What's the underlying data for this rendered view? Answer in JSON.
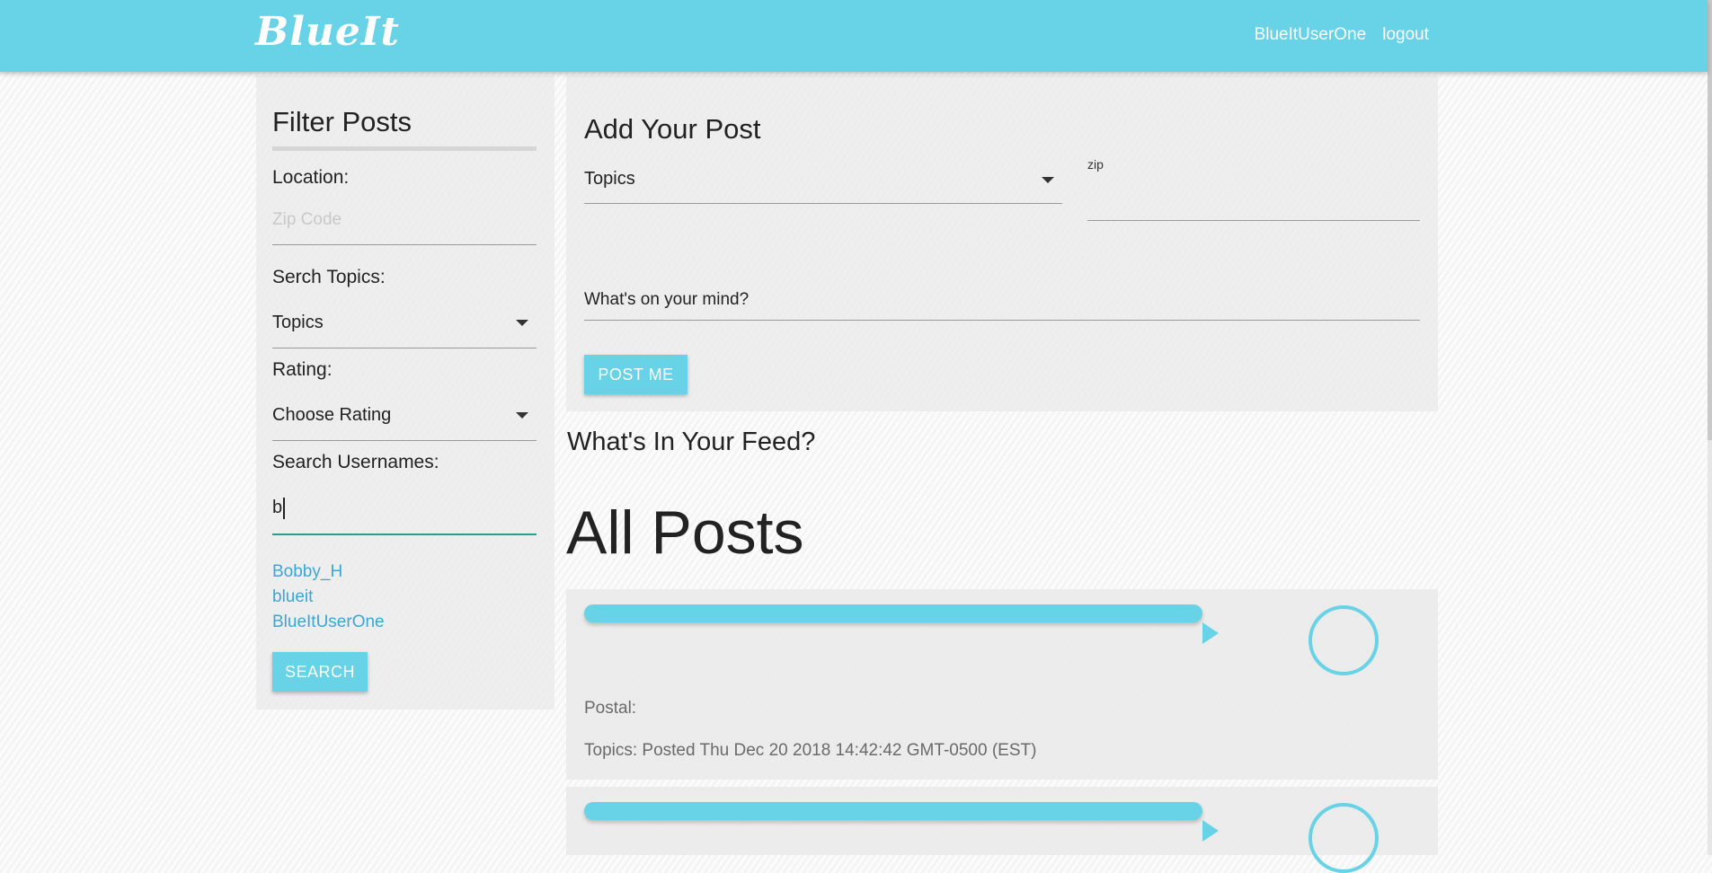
{
  "nav": {
    "brand": "BlueIt",
    "username": "BlueItUserOne",
    "logout": "logout"
  },
  "filter": {
    "title": "Filter Posts",
    "location_label": "Location:",
    "zip_placeholder": "Zip Code",
    "topics_label": "Serch Topics:",
    "topics_value": "Topics",
    "rating_label": "Rating:",
    "rating_value": "Choose Rating",
    "usernames_label": "Search Usernames:",
    "username_input_value": "b",
    "user_results": [
      "Bobby_H",
      "blueit",
      "BlueItUserOne"
    ],
    "search_button": "SEARCH"
  },
  "add_post": {
    "title": "Add Your Post",
    "topics_value": "Topics",
    "zip_label": "zip",
    "message_placeholder": "What's on your mind?",
    "post_button": "POST ME"
  },
  "feed": {
    "heading": "What's In Your Feed?",
    "all_posts_heading": "All Posts",
    "posts": [
      {
        "postal": "Postal:",
        "topics_posted": "Topics: Posted Thu Dec 20 2018 14:42:42 GMT-0500 (EST)"
      },
      {
        "postal": "",
        "topics_posted": ""
      }
    ]
  },
  "colors": {
    "accent": "#68d2e6",
    "link": "#3ba7d2",
    "focus_underline": "#2a9d8f"
  },
  "icons": {
    "dropdown": "caret-down-icon",
    "audio_play": "play-icon",
    "avatar_ring": "circle-icon"
  }
}
